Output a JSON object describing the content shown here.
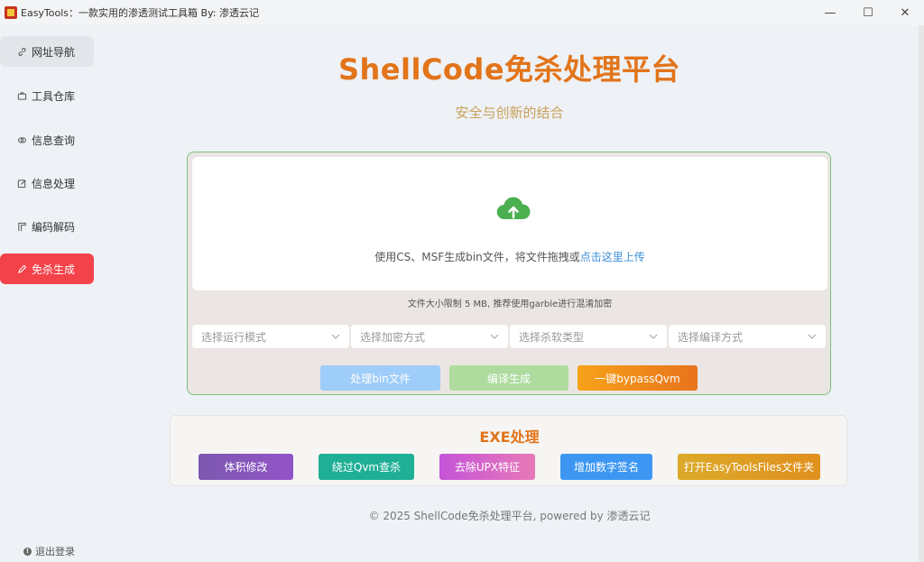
{
  "window": {
    "title": "EasyTools：一款实用的渗透测试工具箱 By: 渗透云记",
    "minimize": "—",
    "maximize": "☐",
    "close": "✕"
  },
  "sidebar": {
    "items": [
      {
        "label": "网址导航",
        "icon": "link-icon"
      },
      {
        "label": "工具仓库",
        "icon": "briefcase-icon"
      },
      {
        "label": "信息查询",
        "icon": "chain-icon"
      },
      {
        "label": "信息处理",
        "icon": "edit-icon"
      },
      {
        "label": "编码解码",
        "icon": "flag-icon"
      },
      {
        "label": "免杀生成",
        "icon": "pencil-icon"
      }
    ],
    "logout": "退出登录"
  },
  "main": {
    "title": "ShellCode免杀处理平台",
    "subtitle": "安全与创新的结合",
    "upload": {
      "prompt": "使用CS、MSF生成bin文件，将文件拖拽或",
      "link": "点击这里上传",
      "hint": "文件大小限制 5 MB, 推荐使用garble进行混淆加密"
    },
    "selects": [
      {
        "placeholder": "选择运行模式"
      },
      {
        "placeholder": "选择加密方式"
      },
      {
        "placeholder": "选择杀软类型"
      },
      {
        "placeholder": "选择编译方式"
      }
    ],
    "buttons": {
      "process_bin": "处理bin文件",
      "compile": "编译生成",
      "bypass": "一键bypassQvm"
    },
    "exe": {
      "title": "EXE处理",
      "buttons": [
        "体积修改",
        "绕过Qvm查杀",
        "去除UPX特征",
        "增加数字签名",
        "打开EasyToolsFiles文件夹"
      ]
    },
    "footer": "© 2025 ShellCode免杀处理平台, powered by 渗透云记"
  },
  "colors": {
    "accent": "#e2741a",
    "active_nav": "#f3424a",
    "upload_green": "#4caf50",
    "link_blue": "#3b8fd8"
  }
}
